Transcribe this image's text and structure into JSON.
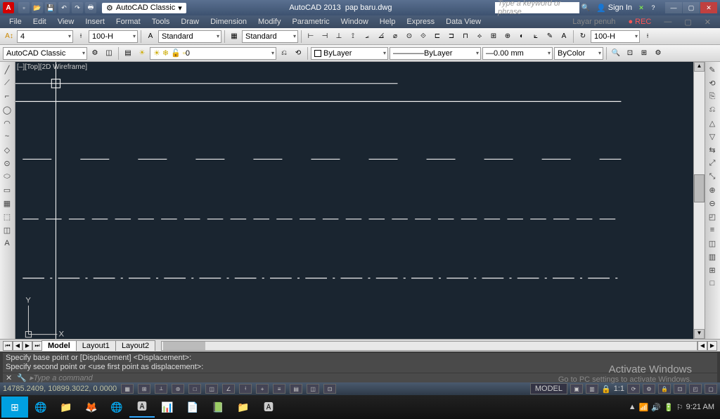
{
  "app": {
    "name": "AutoCAD 2013",
    "file": "pap baru.dwg"
  },
  "titlebar": {
    "workspace_dd": "AutoCAD Classic",
    "search_ph": "Type a keyword or phrase",
    "signin": "Sign In"
  },
  "menu": [
    "File",
    "Edit",
    "View",
    "Insert",
    "Format",
    "Tools",
    "Draw",
    "Dimension",
    "Modify",
    "Parametric",
    "Window",
    "Help",
    "Express",
    "Data View"
  ],
  "menu_right": "Layar penuh",
  "styles_row": {
    "annot_val": "4",
    "dim_style": "100-H",
    "text_style1": "Standard",
    "text_style2": "Standard",
    "lt_scale": "100-H"
  },
  "props_row": {
    "workspace": "AutoCAD Classic",
    "layer_dd": "0",
    "color_dd": "ByLayer",
    "ltype_dd": "ByLayer",
    "lweight_dd": "0.00 mm",
    "plot_dd": "ByColor"
  },
  "viewport_label": "[–][Top][2D Wireframe]",
  "ucs": {
    "x": "X",
    "y": "Y"
  },
  "layout_tabs": [
    "Model",
    "Layout1",
    "Layout2"
  ],
  "cmd": {
    "line1": "Specify base point or [Displacement] <Displacement>:",
    "line2": "Specify second point or <use first point as displacement>:",
    "prompt": "Type a command"
  },
  "status": {
    "coords": "14785.2409, 10899.3022, 0.0000",
    "model": "MODEL",
    "scale": "1:1"
  },
  "activate": {
    "title": "Activate Windows",
    "sub": "Go to PC settings to activate Windows."
  },
  "clock": "9:21 AM",
  "left_tools": [
    "╱",
    "⟋",
    "⌐",
    "◯",
    "◠",
    "~",
    "◇",
    "⊙",
    "⬭",
    "▭",
    "▦",
    "⬚",
    "◫",
    "A"
  ],
  "right_tools": [
    "✎",
    "⟲",
    "⎘",
    "⎌",
    "△",
    "▽",
    "⇆",
    "⤢",
    "⤡",
    "⊕",
    "⊖",
    "◰",
    "≡",
    "◫",
    "▥",
    "⊞",
    "□"
  ],
  "dim_icons": [
    "⊢",
    "⊣",
    "⊥",
    "⟟",
    "⦟",
    "⦞",
    "⌀",
    "⊙",
    "⟐",
    "⊏",
    "⊐",
    "⊓",
    "⟡",
    "⟢",
    "⧉"
  ],
  "find_icons": [
    "🔍",
    "⊡",
    "⊞",
    "⚙"
  ],
  "taskbar_apps": [
    "🌐",
    "📁",
    "🦊",
    "🌐",
    "🅰",
    "📊",
    "📄",
    "📗",
    "📁",
    "🅰"
  ],
  "tray_icons": [
    "▲",
    "📶",
    "🔊",
    "🔋",
    "⚐"
  ]
}
